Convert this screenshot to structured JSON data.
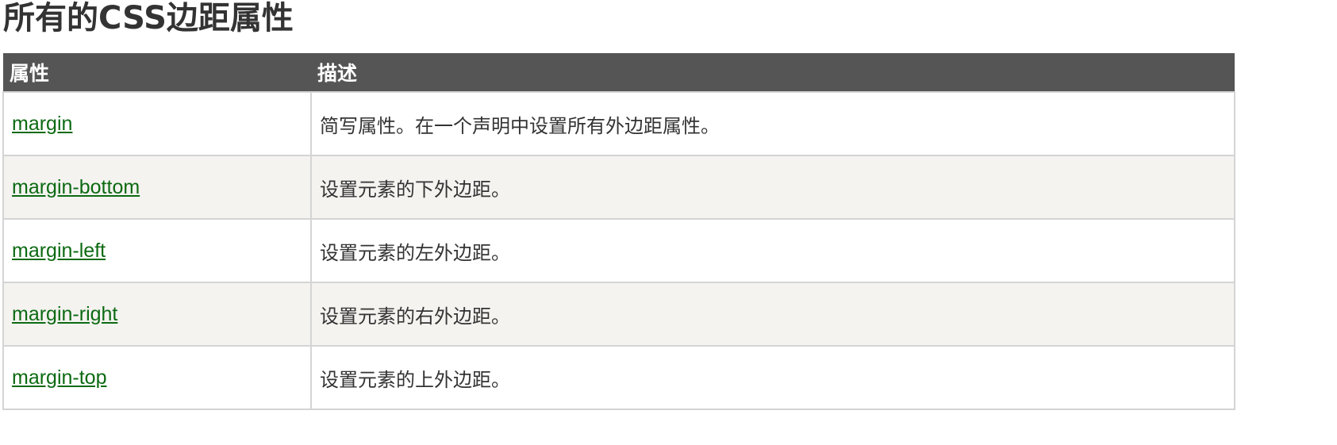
{
  "page": {
    "title": "所有的CSS边距属性"
  },
  "table": {
    "headers": {
      "property": "属性",
      "description": "描述"
    },
    "rows": [
      {
        "property": "margin",
        "description": "简写属性。在一个声明中设置所有外边距属性。"
      },
      {
        "property": "margin-bottom",
        "description": "设置元素的下外边距。"
      },
      {
        "property": "margin-left",
        "description": "设置元素的左外边距。"
      },
      {
        "property": "margin-right",
        "description": "设置元素的右外边距。"
      },
      {
        "property": "margin-top",
        "description": "设置元素的上外边距。"
      }
    ]
  },
  "colors": {
    "header_background": "#555555",
    "header_text": "#ffffff",
    "link": "#0c6a12",
    "alt_row_background": "#f4f3f0",
    "border": "#d4d4d4"
  }
}
